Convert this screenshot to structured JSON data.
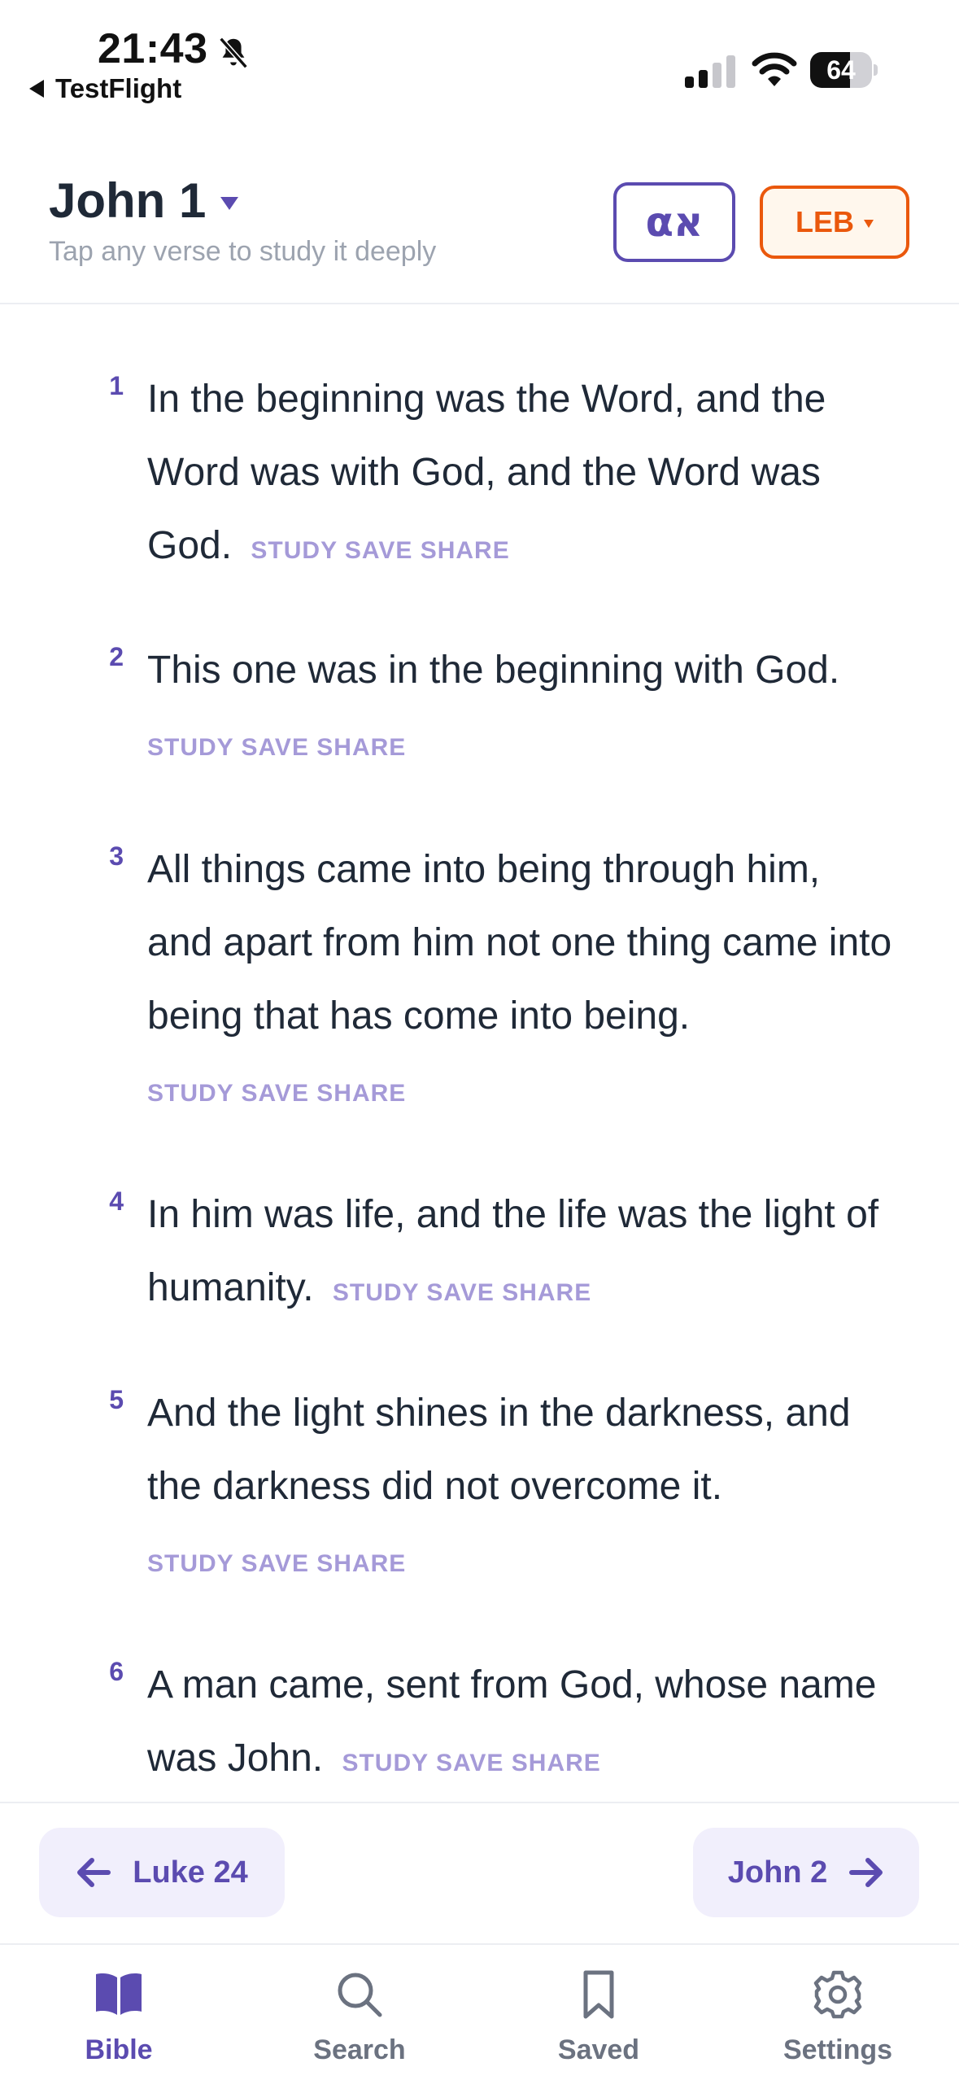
{
  "status_bar": {
    "time": "21:43",
    "back_app": "TestFlight",
    "battery_percent": 64
  },
  "header": {
    "chapter_title": "John 1",
    "subtitle": "Tap any verse to study it deeply",
    "language_toggle_label": "αא",
    "translation_label": "LEB"
  },
  "verse_actions": {
    "study": "STUDY",
    "save": "SAVE",
    "share": "SHARE"
  },
  "verses": [
    {
      "number": "1",
      "text": "In the beginning was the Word, and the Word was with God, and the Word was God."
    },
    {
      "number": "2",
      "text": "This one was in the beginning with God."
    },
    {
      "number": "3",
      "text": "All things came into being through him, and apart from him not one thing came into being that has come into being."
    },
    {
      "number": "4",
      "text": "In him was life, and the life was the light of humanity."
    },
    {
      "number": "5",
      "text": "And the light shines in the darkness, and the darkness did not overcome it."
    },
    {
      "number": "6",
      "text": "A man came, sent from God, whose name was John."
    }
  ],
  "chapter_nav": {
    "prev_label": "Luke 24",
    "next_label": "John 2"
  },
  "tab_bar": {
    "tabs": [
      {
        "label": "Bible",
        "icon": "book-icon",
        "active": true
      },
      {
        "label": "Search",
        "icon": "search-icon",
        "active": false
      },
      {
        "label": "Saved",
        "icon": "bookmark-icon",
        "active": false
      },
      {
        "label": "Settings",
        "icon": "gear-icon",
        "active": false
      }
    ]
  },
  "colors": {
    "accent": "#5b4bb0",
    "action_text": "#a59ad8",
    "translation": "#ea580c",
    "text": "#1f2937",
    "muted": "#9ca3af"
  }
}
